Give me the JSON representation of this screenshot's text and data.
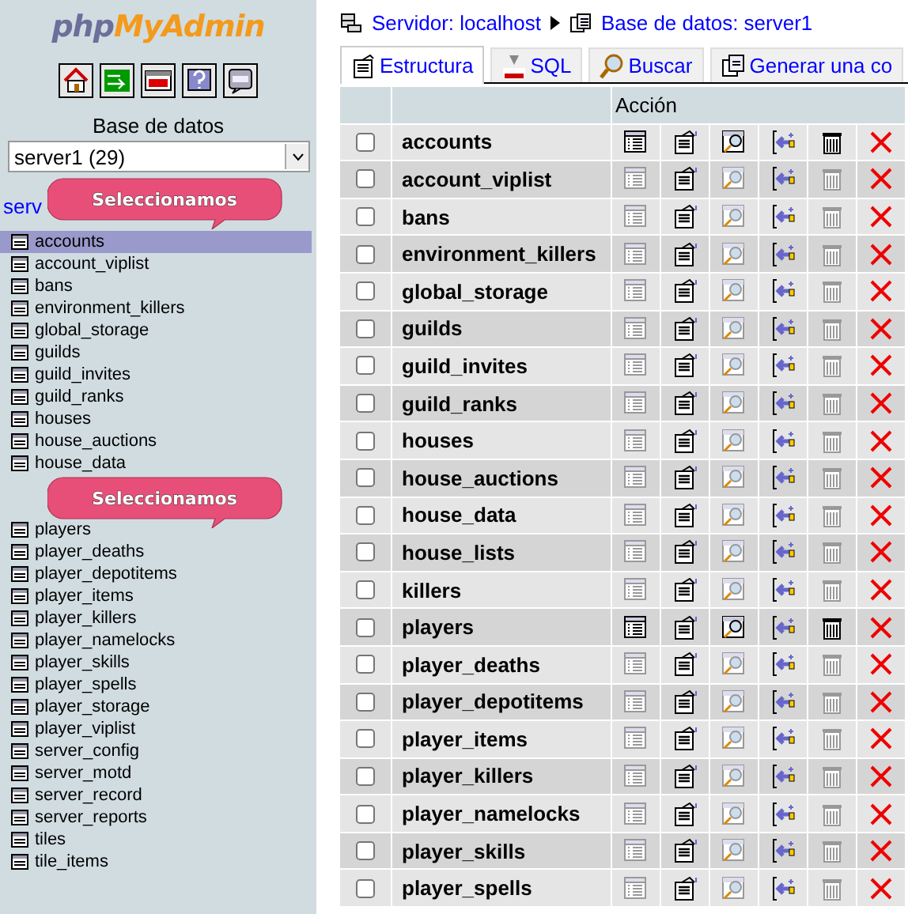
{
  "sidebar": {
    "logo": {
      "prefix": "php",
      "name": "MyAdmin"
    },
    "database_label": "Base de datos",
    "database_select": {
      "value": "server1 (29)"
    },
    "server_link": "serv",
    "callout": "Seleccionamos",
    "tables": [
      {
        "kind": "table",
        "name": "accounts",
        "selected": true
      },
      {
        "kind": "table",
        "name": "account_viplist",
        "selected": false
      },
      {
        "kind": "table",
        "name": "bans",
        "selected": false
      },
      {
        "kind": "table",
        "name": "environment_killers",
        "selected": false
      },
      {
        "kind": "table",
        "name": "global_storage",
        "selected": false
      },
      {
        "kind": "table",
        "name": "guilds",
        "selected": false
      },
      {
        "kind": "table",
        "name": "guild_invites",
        "selected": false
      },
      {
        "kind": "table",
        "name": "guild_ranks",
        "selected": false
      },
      {
        "kind": "table",
        "name": "houses",
        "selected": false
      },
      {
        "kind": "table",
        "name": "house_auctions",
        "selected": false
      },
      {
        "kind": "table",
        "name": "house_data",
        "selected": false
      },
      {
        "kind": "callout",
        "text": "Seleccionamos"
      },
      {
        "kind": "table",
        "name": "players",
        "selected": false
      },
      {
        "kind": "table",
        "name": "player_deaths",
        "selected": false
      },
      {
        "kind": "table",
        "name": "player_depotitems",
        "selected": false
      },
      {
        "kind": "table",
        "name": "player_items",
        "selected": false
      },
      {
        "kind": "table",
        "name": "player_killers",
        "selected": false
      },
      {
        "kind": "table",
        "name": "player_namelocks",
        "selected": false
      },
      {
        "kind": "table",
        "name": "player_skills",
        "selected": false
      },
      {
        "kind": "table",
        "name": "player_spells",
        "selected": false
      },
      {
        "kind": "table",
        "name": "player_storage",
        "selected": false
      },
      {
        "kind": "table",
        "name": "player_viplist",
        "selected": false
      },
      {
        "kind": "table",
        "name": "server_config",
        "selected": false
      },
      {
        "kind": "table",
        "name": "server_motd",
        "selected": false
      },
      {
        "kind": "table",
        "name": "server_record",
        "selected": false
      },
      {
        "kind": "table",
        "name": "server_reports",
        "selected": false
      },
      {
        "kind": "table",
        "name": "tiles",
        "selected": false
      },
      {
        "kind": "table",
        "name": "tile_items",
        "selected": false
      }
    ]
  },
  "breadcrumb": {
    "server": "Servidor: localhost",
    "database": "Base de datos: server1"
  },
  "tabs": [
    {
      "label": "Estructura",
      "selected": true
    },
    {
      "label": "SQL",
      "selected": false
    },
    {
      "label": "Buscar",
      "selected": false
    },
    {
      "label": "Generar una co",
      "selected": false
    }
  ],
  "table": {
    "action_header": "Acción",
    "rows": [
      {
        "name": "accounts",
        "checked": false,
        "has_rows": true
      },
      {
        "name": "account_viplist",
        "checked": false,
        "has_rows": false
      },
      {
        "name": "bans",
        "checked": false,
        "has_rows": false
      },
      {
        "name": "environment_killers",
        "checked": false,
        "has_rows": false
      },
      {
        "name": "global_storage",
        "checked": false,
        "has_rows": false
      },
      {
        "name": "guilds",
        "checked": false,
        "has_rows": false
      },
      {
        "name": "guild_invites",
        "checked": false,
        "has_rows": false
      },
      {
        "name": "guild_ranks",
        "checked": false,
        "has_rows": false
      },
      {
        "name": "houses",
        "checked": false,
        "has_rows": false
      },
      {
        "name": "house_auctions",
        "checked": false,
        "has_rows": false
      },
      {
        "name": "house_data",
        "checked": false,
        "has_rows": false
      },
      {
        "name": "house_lists",
        "checked": false,
        "has_rows": false
      },
      {
        "name": "killers",
        "checked": false,
        "has_rows": false
      },
      {
        "name": "players",
        "checked": false,
        "has_rows": true
      },
      {
        "name": "player_deaths",
        "checked": false,
        "has_rows": false
      },
      {
        "name": "player_depotitems",
        "checked": false,
        "has_rows": false
      },
      {
        "name": "player_items",
        "checked": false,
        "has_rows": false
      },
      {
        "name": "player_killers",
        "checked": false,
        "has_rows": false
      },
      {
        "name": "player_namelocks",
        "checked": false,
        "has_rows": false
      },
      {
        "name": "player_skills",
        "checked": false,
        "has_rows": false
      },
      {
        "name": "player_spells",
        "checked": false,
        "has_rows": false
      }
    ]
  }
}
